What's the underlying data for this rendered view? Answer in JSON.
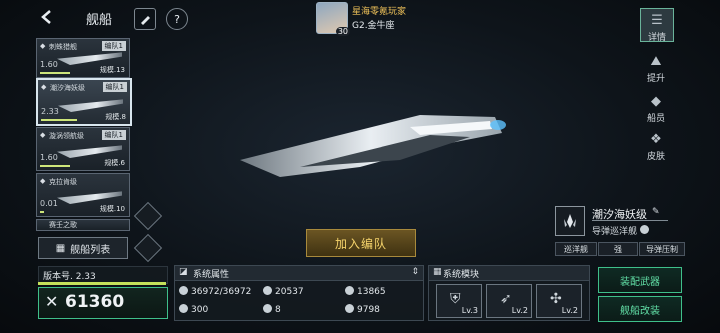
{
  "header": {
    "back_icon": "chevron-left-icon",
    "title": "舰船",
    "brush_icon": "brush-icon",
    "help_icon": "question-icon",
    "help_glyph": "?"
  },
  "player": {
    "name": "星海零氪玩家",
    "level": "30",
    "rank": "G2.金牛座"
  },
  "ship_list": [
    {
      "name": "刺蛛猎舰",
      "tag": "编队1",
      "level": "1.60",
      "scale": "规模.13"
    },
    {
      "name": "潮汐海妖级",
      "tag": "编队1",
      "level": "2.33",
      "scale": "规模.8"
    },
    {
      "name": "漩涡领航级",
      "tag": "编队1",
      "level": "1.60",
      "scale": "规模.6"
    },
    {
      "name": "克拉肯级",
      "tag": "",
      "level": "0.01",
      "scale": "规模.10"
    },
    {
      "name": "赛壬之歌",
      "tag": "",
      "level": "",
      "scale": ""
    }
  ],
  "ship_list_button": "舰船列表",
  "side_tabs": [
    {
      "label": "详情",
      "icon": "list-icon"
    },
    {
      "label": "提升",
      "icon": "upgrade-icon"
    },
    {
      "label": "船员",
      "icon": "crew-icon"
    },
    {
      "label": "皮肤",
      "icon": "skin-icon"
    }
  ],
  "ship_info": {
    "name": "潮汐海妖级",
    "type": "导弹巡洋舰",
    "roles": [
      "巡洋舰",
      "强",
      "导弹压制"
    ]
  },
  "join_button": "加入编队",
  "version": {
    "label": "版本号. 2.33",
    "power": "61360"
  },
  "attributes": {
    "title": "系统属性",
    "stats": [
      {
        "icon": "hull-icon",
        "value": "36972/36972"
      },
      {
        "icon": "attack-icon",
        "value": "20537"
      },
      {
        "icon": "shield-icon",
        "value": "13865"
      },
      {
        "icon": "speed-icon",
        "value": "300"
      },
      {
        "icon": "grid-icon",
        "value": "8"
      },
      {
        "icon": "cargo-icon",
        "value": "9798"
      }
    ]
  },
  "modules": {
    "title": "系统模块",
    "items": [
      {
        "icon": "shield-module-icon",
        "level": "Lv.3"
      },
      {
        "icon": "missile-module-icon",
        "level": "Lv.2"
      },
      {
        "icon": "cannon-module-icon",
        "level": "Lv.2"
      }
    ]
  },
  "buttons": {
    "equip": "装配武器",
    "modify": "舰船改装"
  }
}
